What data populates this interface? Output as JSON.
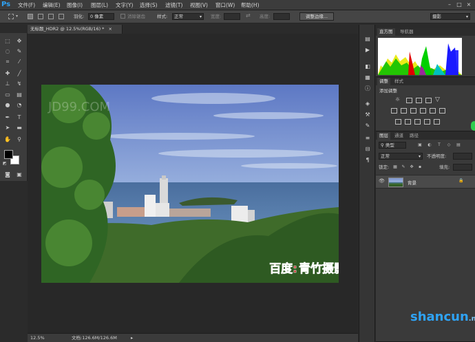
{
  "app": {
    "logo": "Ps"
  },
  "menu": [
    "文件(F)",
    "编辑(E)",
    "图像(I)",
    "图层(L)",
    "文字(Y)",
    "选择(S)",
    "滤镜(T)",
    "视图(V)",
    "窗口(W)",
    "帮助(H)"
  ],
  "window_controls": {
    "minimize": "–",
    "maximize": "□",
    "close": "×"
  },
  "options": {
    "feather_label": "羽化:",
    "feather_value": "0 像素",
    "antialias_label": "消除锯齿",
    "style_label": "样式:",
    "style_value": "正常",
    "width_label": "宽度:",
    "height_label": "高度:",
    "refine_edge": "调整边缘...",
    "workspace": "摄影"
  },
  "document": {
    "tab_title": "无标题_HDR2 @ 12.5%(RGB/16) *",
    "tab_close": "×",
    "zoom": "12.5%",
    "doc_info": "文档:126.6M/126.6M",
    "status_arrow": "▸",
    "watermark_baidu": "百度:",
    "watermark_name": "青竹摄影",
    "watermark_faint": "JD99.COM"
  },
  "histogram_panel": {
    "tabs": [
      "直方图",
      "导航器"
    ]
  },
  "adjustments_panel": {
    "tabs": [
      "调整",
      "样式"
    ],
    "add_label": "添加调整"
  },
  "layers_panel": {
    "tabs": [
      "图层",
      "通道",
      "路径"
    ],
    "filter_type": "类型",
    "blend_mode": "正常",
    "opacity_label": "不透明度:",
    "lock_label": "锁定:",
    "fill_label": "填充:",
    "layer_name": "背景",
    "visibility_icon": "👁",
    "lock_icon": "🔒"
  },
  "site_watermark": {
    "name": "shancun",
    "domain": ".net"
  },
  "colors": {
    "accent": "#2fa3f5",
    "panel_bg": "#3a3a3a",
    "canvas_bg": "#282828"
  }
}
